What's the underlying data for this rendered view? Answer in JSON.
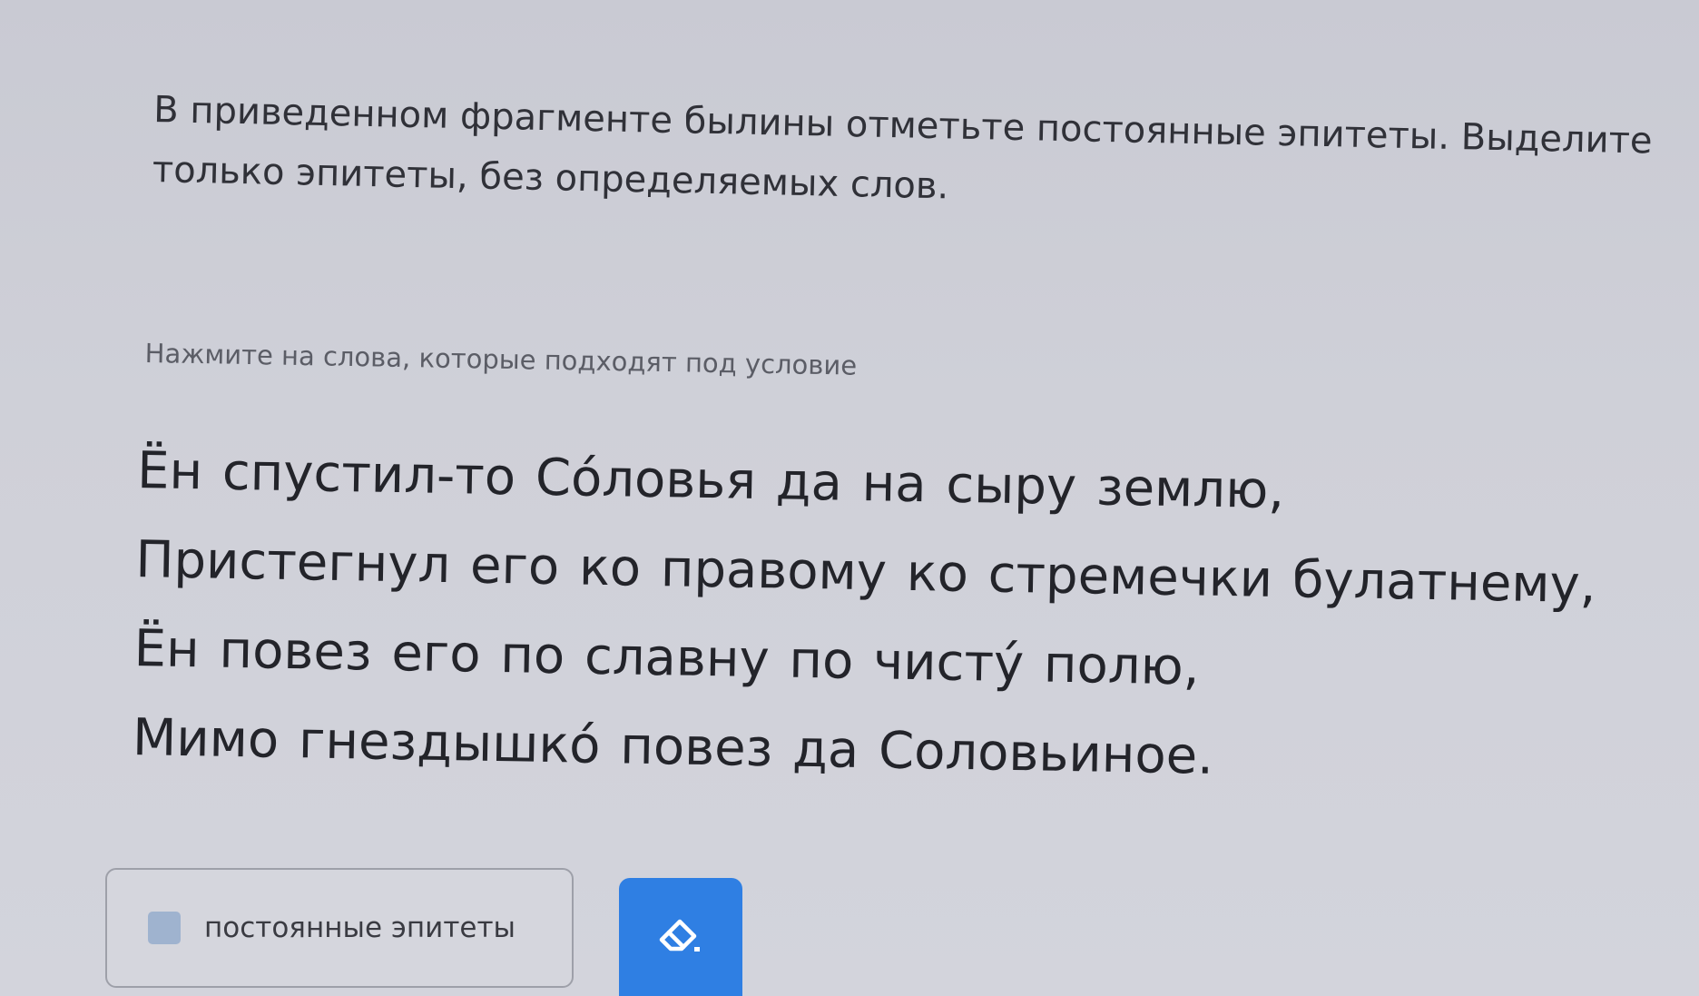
{
  "task": {
    "line1": "В приведенном фрагменте былины отметьте постоянные эпитеты. Выделите",
    "line2": "только эпитеты, без определяемых слов."
  },
  "hint": "Нажмите на слова, которые подходят под условие",
  "poem": {
    "lines": [
      [
        "Ён",
        "спустил-то",
        "Со́ловья",
        "да",
        "на",
        "сыру",
        "землю,"
      ],
      [
        "Пристегнул",
        "его",
        "ко",
        "правому",
        "ко",
        "стремечки",
        "булатнему,"
      ],
      [
        "Ён",
        "повез",
        "его",
        "по",
        "славну",
        "по",
        "чисту́",
        "полю,"
      ],
      [
        "Мимо",
        "гнездышко́",
        "повез",
        "да",
        "Соловьиное."
      ]
    ]
  },
  "category": {
    "label": "постоянные эпитеты",
    "swatch_color": "#9fb3cf"
  },
  "eraser": {
    "icon": "eraser-icon",
    "color": "#2f7fe3"
  }
}
